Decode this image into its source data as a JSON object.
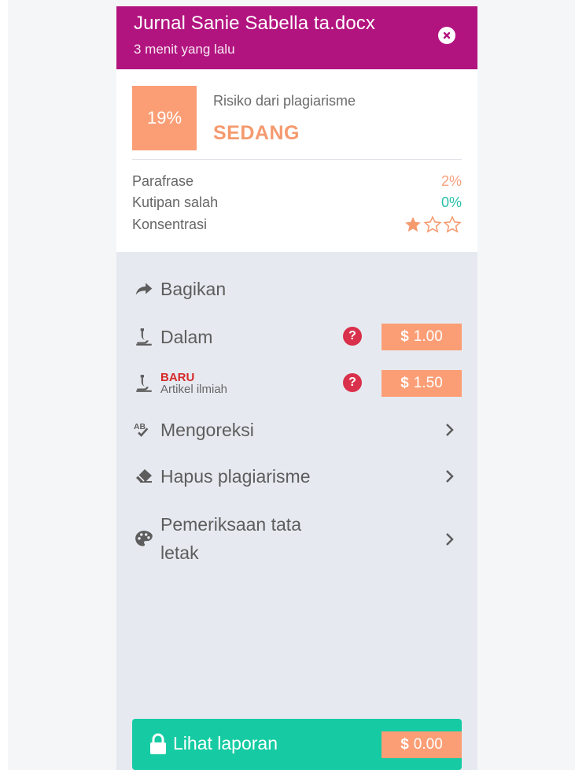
{
  "header": {
    "title": "Jurnal Sanie Sabella ta.docx",
    "subtitle": "3 menit yang lalu",
    "close_icon": "close-circle-icon"
  },
  "summary": {
    "risk_percent": "19%",
    "risk_label": "Risiko dari plagiarisme",
    "risk_level": "SEDANG",
    "metrics": [
      {
        "label": "Parafrase",
        "value": "2%",
        "color": "#f7a27e"
      },
      {
        "label": "Kutipan salah",
        "value": "0%",
        "color": "#27bfa8"
      },
      {
        "label": "Konsentrasi",
        "stars_filled": 1,
        "stars_total": 3,
        "color": "#f59a6f"
      }
    ]
  },
  "menu": {
    "share": {
      "label": "Bagikan",
      "icon": "share-arrow-icon"
    },
    "deep": {
      "label": "Dalam",
      "icon": "microscope-icon",
      "price_symbol": "$",
      "price": "1.00"
    },
    "scientific": {
      "badge": "BARU",
      "label": "Artikel ilmiah",
      "icon": "microscope-icon",
      "price_symbol": "$",
      "price": "1.50"
    },
    "proofread": {
      "label": "Mengoreksi",
      "icon": "spellcheck-icon"
    },
    "remove": {
      "label": "Hapus plagiarisme",
      "icon": "eraser-icon"
    },
    "layout_line1": "Pemeriksaan tata",
    "layout_line2": "letak",
    "layout_icon": "palette-icon"
  },
  "report": {
    "label": "Lihat laporan",
    "icon": "lock-icon",
    "price_symbol": "$",
    "price": "0.00"
  },
  "colors": {
    "header": "#b2147f",
    "accent": "#fb9e76",
    "teal": "#16cba3",
    "help": "#d9304b"
  }
}
